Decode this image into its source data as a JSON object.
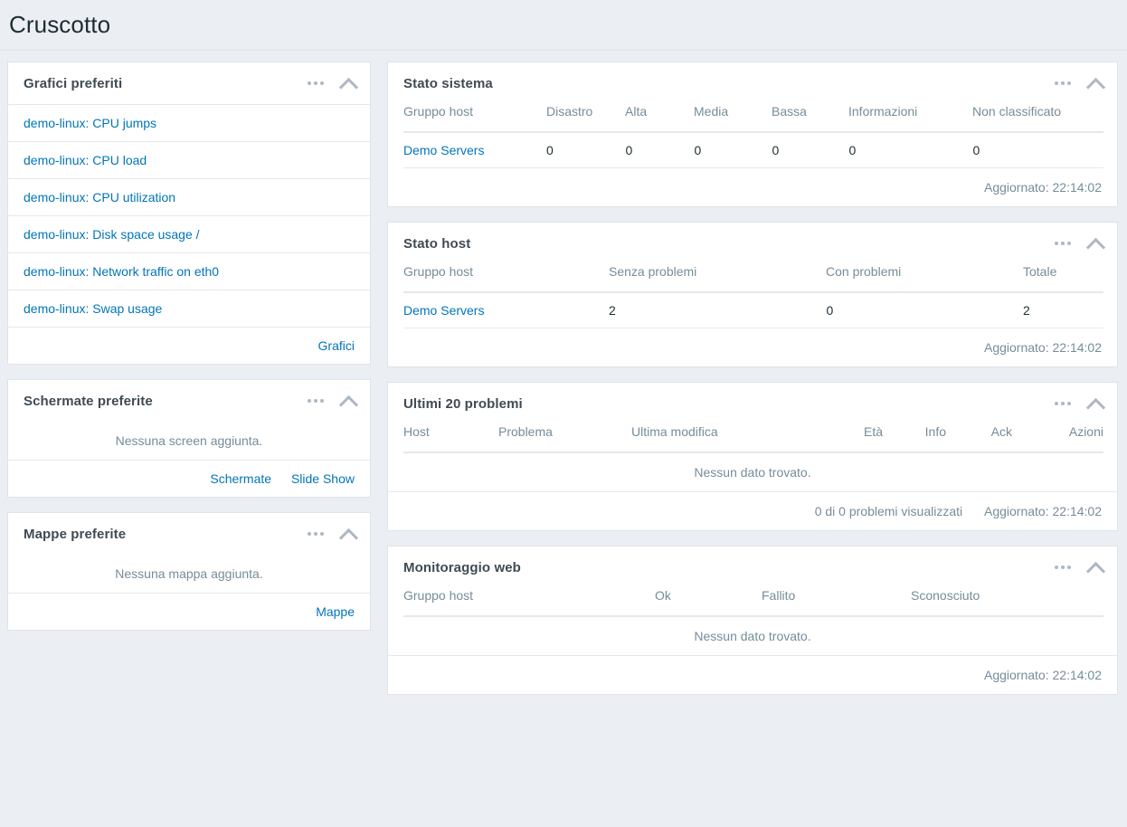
{
  "page": {
    "title": "Cruscotto"
  },
  "icons": {
    "menu": "kebab-menu-icon",
    "collapse": "chevron-up-icon"
  },
  "colors": {
    "green": "#59db95",
    "link": "#0275b8",
    "muted": "#768d99",
    "background": "#ebeef2",
    "border": "#dfe4e9"
  },
  "left_column": {
    "favourite_graphs": {
      "title": "Grafici preferiti",
      "items": [
        "demo-linux: CPU jumps",
        "demo-linux: CPU load",
        "demo-linux: CPU utilization",
        "demo-linux: Disk space usage /",
        "demo-linux: Network traffic on eth0",
        "demo-linux: Swap usage"
      ],
      "footer_links": [
        "Grafici"
      ]
    },
    "favourite_screens": {
      "title": "Schermate preferite",
      "empty_text": "Nessuna screen aggiunta.",
      "footer_links": [
        "Schermate",
        "Slide Show"
      ]
    },
    "favourite_maps": {
      "title": "Mappe preferite",
      "empty_text": "Nessuna mappa aggiunta.",
      "footer_links": [
        "Mappe"
      ]
    }
  },
  "right_column": {
    "system_status": {
      "title": "Stato sistema",
      "headers": [
        "Gruppo host",
        "Disastro",
        "Alta",
        "Media",
        "Bassa",
        "Informazioni",
        "Non classificato"
      ],
      "rows": [
        {
          "group": "Demo Servers",
          "values": [
            "0",
            "0",
            "0",
            "0",
            "0",
            "0"
          ]
        }
      ],
      "updated_label": "Aggiornato: 22:14:02"
    },
    "host_status": {
      "title": "Stato host",
      "headers": [
        "Gruppo host",
        "Senza problemi",
        "Con problemi",
        "Totale"
      ],
      "rows": [
        {
          "group": "Demo Servers",
          "ok": "2",
          "failed": "0",
          "total": "2"
        }
      ],
      "updated_label": "Aggiornato: 22:14:02"
    },
    "last_problems": {
      "title": "Ultimi 20 problemi",
      "headers": [
        "Host",
        "Problema",
        "Ultima modifica",
        "Età",
        "Info",
        "Ack",
        "Azioni"
      ],
      "empty_text": "Nessun dato trovato.",
      "count_label": "0 di 0 problemi visualizzati",
      "updated_label": "Aggiornato: 22:14:02"
    },
    "web_monitoring": {
      "title": "Monitoraggio web",
      "headers": [
        "Gruppo host",
        "Ok",
        "Fallito",
        "Sconosciuto"
      ],
      "empty_text": "Nessun dato trovato.",
      "updated_label": "Aggiornato: 22:14:02"
    }
  }
}
